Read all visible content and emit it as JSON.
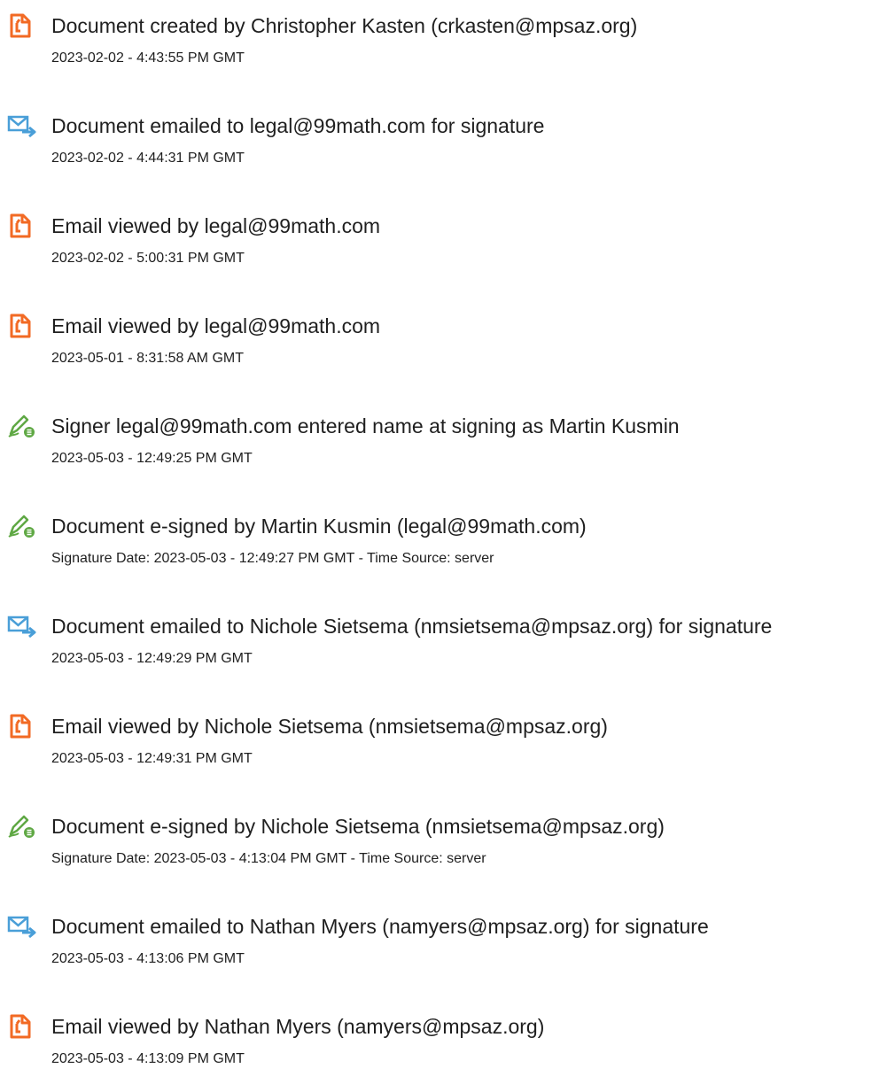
{
  "icons": {
    "created": "document-orange-icon",
    "emailed": "envelope-arrow-icon",
    "viewed": "document-orange-icon",
    "signed": "pen-signature-icon"
  },
  "colors": {
    "document_icon": "#f26a24",
    "email_icon": "#4a9fd8",
    "sign_icon": "#5fa844",
    "text": "#1f1f1f"
  },
  "entries": [
    {
      "type": "created",
      "title": "Document created by Christopher Kasten (crkasten@mpsaz.org)",
      "date": "2023-02-02 - 4:43:55 PM GMT"
    },
    {
      "type": "emailed",
      "title": "Document emailed to legal@99math.com for signature",
      "date": "2023-02-02 - 4:44:31 PM GMT"
    },
    {
      "type": "viewed",
      "title": "Email viewed by legal@99math.com",
      "date": "2023-02-02 - 5:00:31 PM GMT"
    },
    {
      "type": "viewed",
      "title": "Email viewed by legal@99math.com",
      "date": "2023-05-01 - 8:31:58 AM GMT"
    },
    {
      "type": "signed",
      "title": "Signer legal@99math.com entered name at signing as Martin Kusmin",
      "date": "2023-05-03 - 12:49:25 PM GMT"
    },
    {
      "type": "signed",
      "title": "Document e-signed by Martin Kusmin (legal@99math.com)",
      "date": "Signature Date: 2023-05-03 - 12:49:27 PM GMT - Time Source: server"
    },
    {
      "type": "emailed",
      "title": "Document emailed to Nichole Sietsema (nmsietsema@mpsaz.org) for signature",
      "date": "2023-05-03 - 12:49:29 PM GMT"
    },
    {
      "type": "viewed",
      "title": "Email viewed by Nichole Sietsema (nmsietsema@mpsaz.org)",
      "date": "2023-05-03 - 12:49:31 PM GMT"
    },
    {
      "type": "signed",
      "title": "Document e-signed by Nichole Sietsema (nmsietsema@mpsaz.org)",
      "date": "Signature Date: 2023-05-03 - 4:13:04 PM GMT - Time Source: server"
    },
    {
      "type": "emailed",
      "title": "Document emailed to Nathan Myers (namyers@mpsaz.org) for signature",
      "date": "2023-05-03 - 4:13:06 PM GMT"
    },
    {
      "type": "viewed",
      "title": "Email viewed by Nathan Myers (namyers@mpsaz.org)",
      "date": "2023-05-03 - 4:13:09 PM GMT"
    }
  ]
}
